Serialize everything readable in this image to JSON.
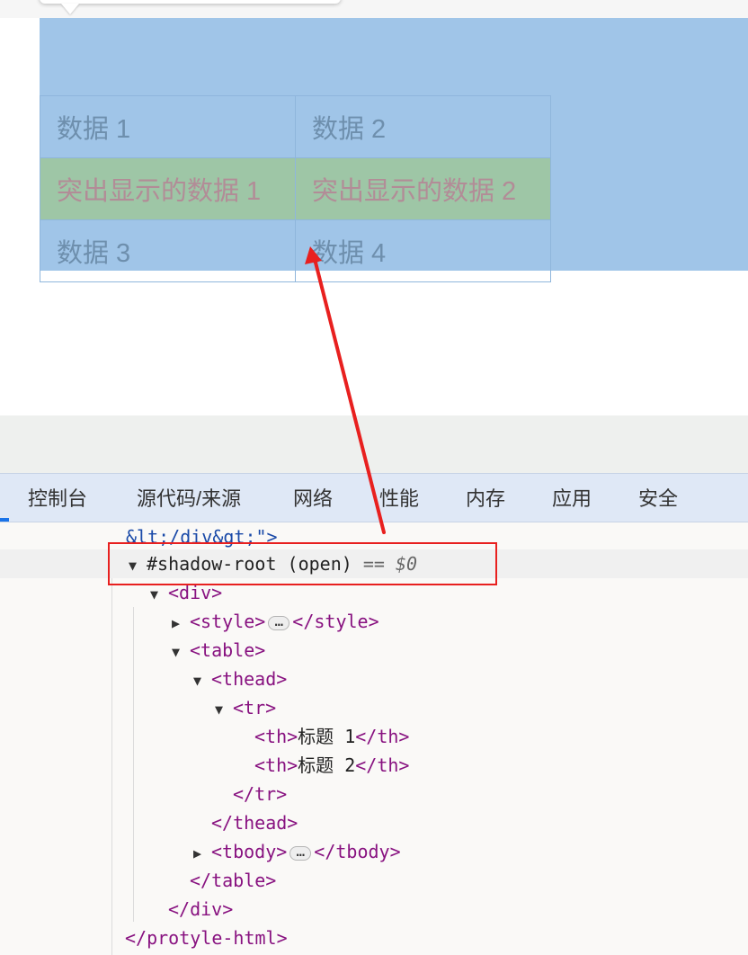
{
  "table": {
    "rows": [
      {
        "cells": [
          "数据 1",
          "数据 2"
        ],
        "highlighted": false
      },
      {
        "cells": [
          "突出显示的数据 1",
          "突出显示的数据 2"
        ],
        "highlighted": true
      },
      {
        "cells": [
          "数据 3",
          "数据 4"
        ],
        "highlighted": false
      }
    ]
  },
  "devtools": {
    "tabs": [
      "控制台",
      "源代码/来源",
      "网络",
      "性能",
      "内存",
      "应用",
      "安全"
    ],
    "dom_lines": {
      "attr_tail": "&lt;/div&gt;\">",
      "shadow_root": "#shadow-root",
      "shadow_mode": "(open)",
      "shadow_eq": "==",
      "shadow_var": "$0",
      "div_open": "<div>",
      "style_open": "<style>",
      "style_close": "</style>",
      "table_open": "<table>",
      "thead_open": "<thead>",
      "tr_open": "<tr>",
      "th_open": "<th>",
      "th_close": "</th>",
      "th1_text": "标题 1",
      "th2_text": "标题 2",
      "tr_close": "</tr>",
      "thead_close": "</thead>",
      "tbody_open": "<tbody>",
      "tbody_close": "</tbody>",
      "table_close": "</table>",
      "div_close": "</div>",
      "protyle_close": "</protyle-html>"
    },
    "ellipsis": "…"
  },
  "colors": {
    "highlight_overlay": "#a0c5e8",
    "highlight_row": "#9ec6a6",
    "annotation_red": "#e8201f"
  }
}
